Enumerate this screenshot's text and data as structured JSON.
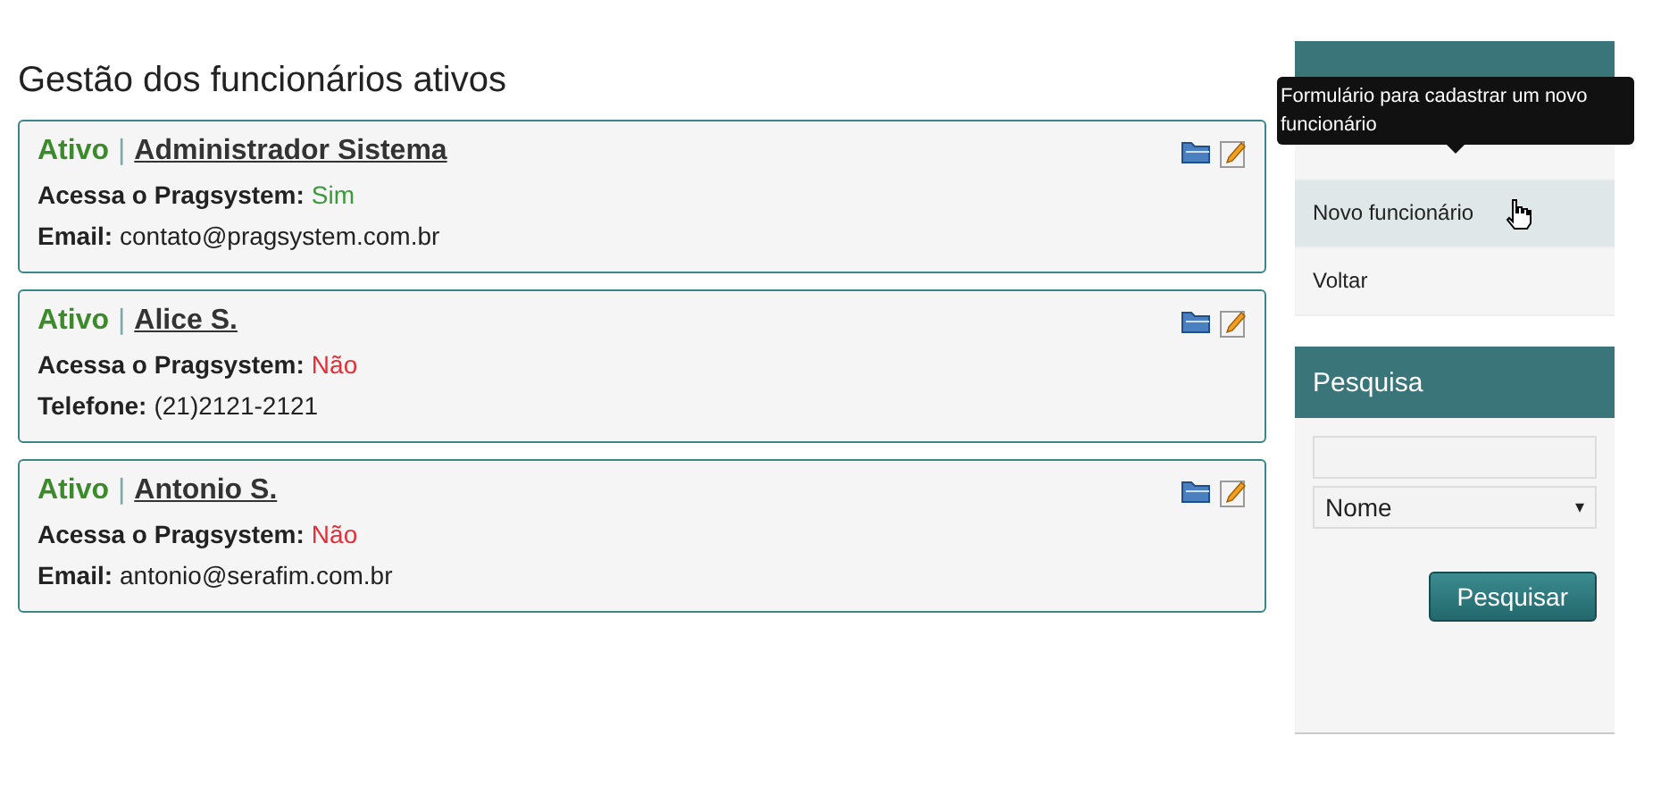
{
  "page_title": "Gestão dos funcionários ativos",
  "employees": [
    {
      "status": "Ativo",
      "separator": "|",
      "name": "Administrador Sistema",
      "access_label": "Acessa o Pragsystem:",
      "access_value": "Sim",
      "access": true,
      "contact_label": "Email:",
      "contact_value": "contato@pragsystem.com.br"
    },
    {
      "status": "Ativo",
      "separator": "|",
      "name": "Alice S.",
      "access_label": "Acessa o Pragsystem:",
      "access_value": "Não",
      "access": false,
      "contact_label": "Telefone:",
      "contact_value": "(21)2121-2121"
    },
    {
      "status": "Ativo",
      "separator": "|",
      "name": "Antonio S.",
      "access_label": "Acessa o Pragsystem:",
      "access_value": "Não",
      "access": false,
      "contact_label": "Email:",
      "contact_value": "antonio@serafim.com.br"
    }
  ],
  "sidebar": {
    "items": [
      {
        "highlighted": false
      },
      {
        "label": "Novo funcionário",
        "highlighted": true
      },
      {
        "label": "Voltar",
        "highlighted": false
      }
    ],
    "tooltip": "Formulário para cadastrar um novo funcionário"
  },
  "search": {
    "title": "Pesquisa",
    "field_select": "Nome",
    "select_arrow": "▾",
    "button": "Pesquisar"
  }
}
